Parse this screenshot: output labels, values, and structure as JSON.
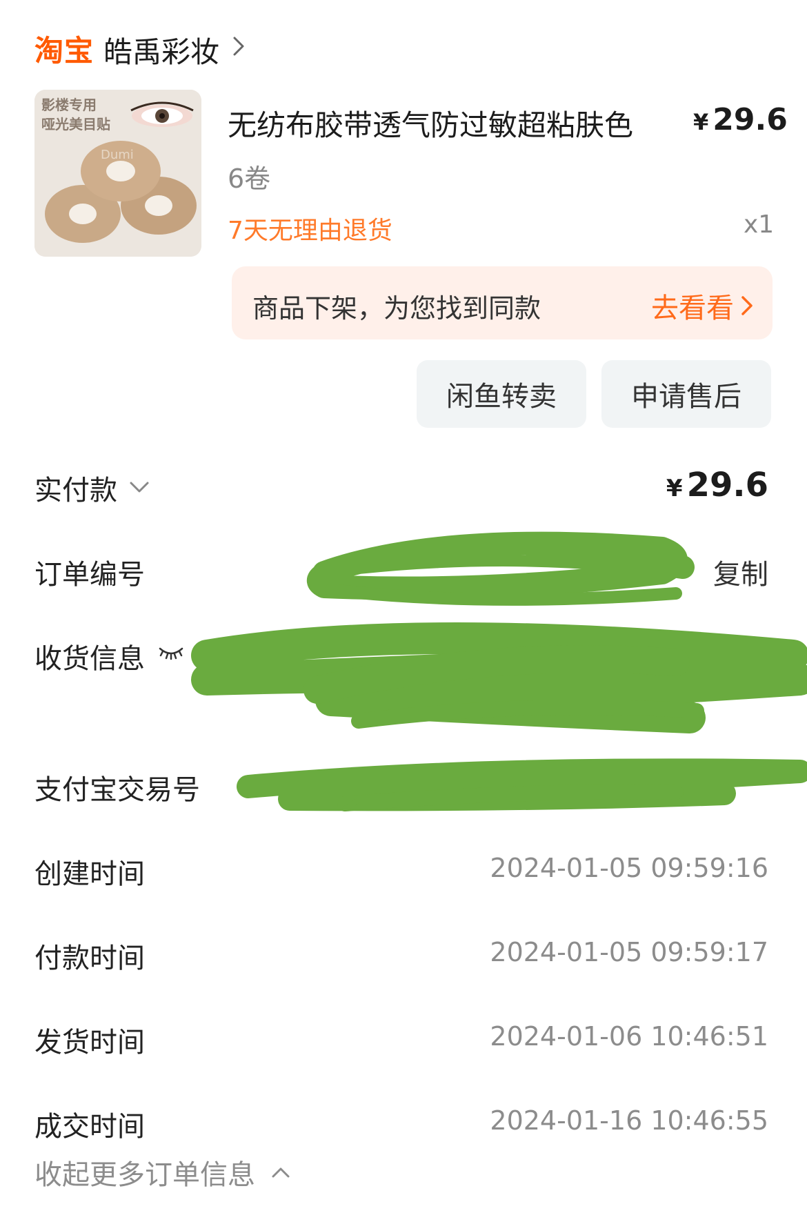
{
  "header": {
    "platform": "淘宝",
    "shop_name": "皓禹彩妆"
  },
  "product": {
    "thumb_text_line1": "影楼专用",
    "thumb_text_line2": "哑光美目贴",
    "title": "无纺布胶带透气防过敏超粘肤色",
    "price_symbol": "¥",
    "price": "29.6",
    "spec": "6卷",
    "return_policy": "7天无理由退货",
    "quantity": "x1"
  },
  "banner": {
    "text": "商品下架，为您找到同款",
    "link": "去看看"
  },
  "actions": {
    "resell": "闲鱼转卖",
    "after_sale": "申请售后"
  },
  "payment": {
    "label": "实付款",
    "symbol": "¥",
    "amount": "29.6"
  },
  "order_info": {
    "order_number_label": "订单编号",
    "copy": "复制",
    "shipping_label": "收货信息",
    "alipay_label": "支付宝交易号",
    "created_label": "创建时间",
    "created_value": "2024-01-05 09:59:16",
    "paid_label": "付款时间",
    "paid_value": "2024-01-05 09:59:17",
    "shipped_label": "发货时间",
    "shipped_value": "2024-01-06 10:46:51",
    "completed_label": "成交时间",
    "completed_value": "2024-01-16 10:46:55",
    "collapse": "收起更多订单信息"
  },
  "colors": {
    "brand_orange": "#ff5a00",
    "accent_orange": "#ff6a1a",
    "banner_bg": "#fff0ea",
    "redaction_green": "#6aab3f"
  }
}
